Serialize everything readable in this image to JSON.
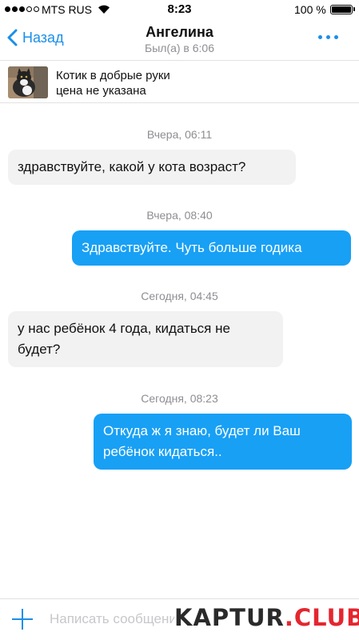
{
  "status_bar": {
    "carrier": "MTS RUS",
    "time": "8:23",
    "battery": "100 %",
    "signal_bars_filled": 3,
    "signal_bars_total": 5
  },
  "nav": {
    "back_label": "Назад",
    "contact_name": "Ангелина",
    "last_seen": "Был(а) в 6:06"
  },
  "listing": {
    "title": "Котик в добрые руки",
    "price": "цена не указана"
  },
  "messages": [
    {
      "timestamp": "Вчера, 06:11",
      "direction": "incoming",
      "text": "здравствуйте, какой у кота возраст?"
    },
    {
      "timestamp": "Вчера, 08:40",
      "direction": "outgoing",
      "text": "Здравствуйте. Чуть больше годика"
    },
    {
      "timestamp": "Сегодня, 04:45",
      "direction": "incoming",
      "text": "у нас ребёнок 4 года, кидаться не будет?"
    },
    {
      "timestamp": "Сегодня, 08:23",
      "direction": "outgoing",
      "text": "Откуда ж я знаю, будет ли Ваш ребёнок кидаться.."
    }
  ],
  "composer": {
    "placeholder": "Написать сообщение"
  },
  "watermark": {
    "part1": "KAPTUR",
    "part2": ".CLUB"
  },
  "colors": {
    "accent": "#1a8fe8",
    "outgoing_bubble": "#18a0f5",
    "incoming_bubble": "#f2f2f2",
    "timestamp": "#8e8e93"
  }
}
